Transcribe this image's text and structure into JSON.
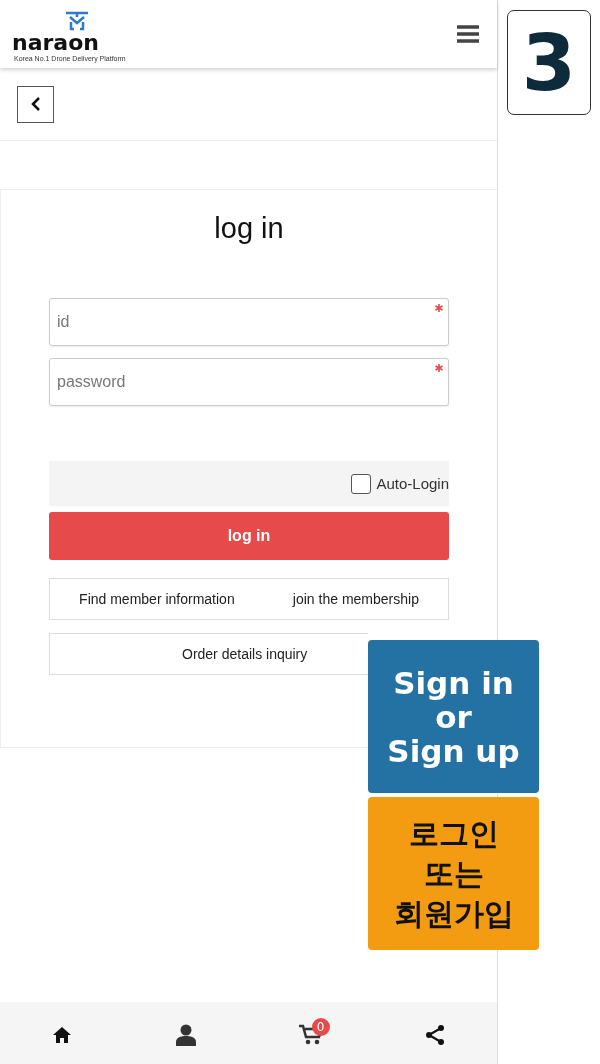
{
  "header": {
    "logo": {
      "name": "naraon",
      "tagline": "Korea No.1 Drone Delivery Platform"
    }
  },
  "step_badge": "3",
  "login": {
    "title": "log in",
    "fields": [
      {
        "placeholder": "id",
        "required": true
      },
      {
        "placeholder": "password",
        "required": true
      }
    ],
    "auto_login": {
      "label": "Auto-Login",
      "checked": false
    },
    "submit": "log in",
    "links": [
      "Find member information",
      "join the membership"
    ],
    "order_inquiry": "Order details inquiry"
  },
  "callouts": [
    {
      "text": "Sign in\nor\nSign up",
      "color": "#2471a3"
    },
    {
      "text": "로그인\n또는\n회원가입",
      "color": "#f39c12"
    }
  ],
  "bottom_nav": [
    {
      "kind": "home"
    },
    {
      "kind": "user"
    },
    {
      "kind": "cart",
      "badge": "0"
    },
    {
      "kind": "share"
    }
  ]
}
